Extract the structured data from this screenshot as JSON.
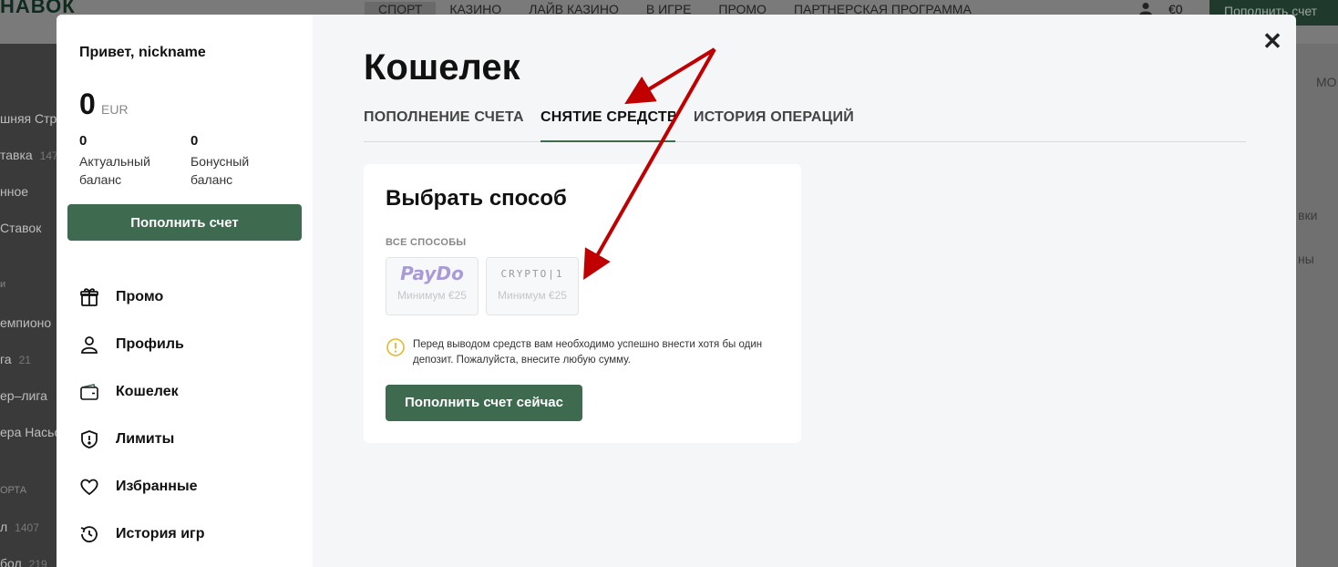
{
  "background": {
    "logo": "НАВОК",
    "nav": [
      "СПОРТ",
      "КАЗИНО",
      "ЛАЙВ КАЗИНО",
      "В ИГРЕ",
      "ПРОМО",
      "ПАРТНЕРСКАЯ ПРОГРАММА"
    ],
    "balance": "€0",
    "topup": "Пополнить счет",
    "left_items": [
      {
        "label": "шняя Стра",
        "count": ""
      },
      {
        "label": "тавка",
        "count": "147"
      },
      {
        "label": "нное",
        "count": ""
      },
      {
        "label": "Ставок",
        "count": ""
      },
      {
        "label": "и",
        "count": ""
      },
      {
        "label": "емпионо",
        "count": ""
      },
      {
        "label": "га",
        "count": "21"
      },
      {
        "label": "ер–лига",
        "count": ""
      },
      {
        "label": "ера Насьо",
        "count": ""
      },
      {
        "label": "ОРТА",
        "count": ""
      },
      {
        "label": "л",
        "count": "1407"
      },
      {
        "label": "бол",
        "count": "219"
      }
    ],
    "right_items": [
      "МО",
      "вки",
      "ны"
    ]
  },
  "sidebar": {
    "greeting": "Привет, nickname",
    "balance": "0",
    "currency": "EUR",
    "actual": {
      "value": "0",
      "label": "Актуальный баланс"
    },
    "bonus": {
      "value": "0",
      "label": "Бонусный баланс"
    },
    "topup_button": "Пополнить счет",
    "menu": [
      {
        "label": "Промо",
        "icon": "gift-icon"
      },
      {
        "label": "Профиль",
        "icon": "user-icon"
      },
      {
        "label": "Кошелек",
        "icon": "wallet-icon"
      },
      {
        "label": "Лимиты",
        "icon": "shield-icon"
      },
      {
        "label": "Избранные",
        "icon": "heart-icon"
      },
      {
        "label": "История игр",
        "icon": "history-icon"
      }
    ]
  },
  "wallet": {
    "title": "Кошелек",
    "tabs": [
      "ПОПОЛНЕНИЕ СЧЕТА",
      "СНЯТИЕ СРЕДСТВ",
      "ИСТОРИЯ ОПЕРАЦИЙ"
    ],
    "active_tab": 1,
    "card_title": "Выбрать способ",
    "all_methods_label": "ВСЕ СПОСОБЫ",
    "methods": [
      {
        "name": "PayDo",
        "min": "Минимум €25"
      },
      {
        "name": "CRYPTO|1",
        "min": "Минимум €25"
      }
    ],
    "warning": "Перед выводом средств вам необходимо успешно внести хотя бы один депозит. Пожалуйста, внесите любую сумму.",
    "deposit_now_button": "Пополнить счет сейчас"
  },
  "colors": {
    "accent": "#3e6a4f",
    "warning": "#e8b82a",
    "annotation_arrow": "#c00000"
  }
}
